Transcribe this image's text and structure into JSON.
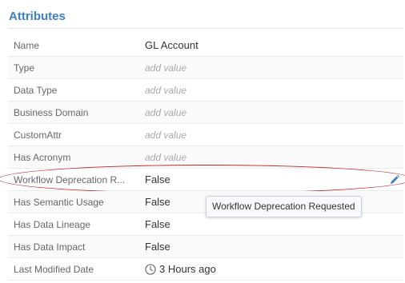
{
  "section": {
    "title": "Attributes"
  },
  "attributes": [
    {
      "label": "Name",
      "value": "GL Account",
      "placeholder": false
    },
    {
      "label": "Type",
      "value": "add value",
      "placeholder": true
    },
    {
      "label": "Data Type",
      "value": "add value",
      "placeholder": true
    },
    {
      "label": "Business Domain",
      "value": "add value",
      "placeholder": true
    },
    {
      "label": "CustomAttr",
      "value": "add value",
      "placeholder": true
    },
    {
      "label": "Has Acronym",
      "value": "add value",
      "placeholder": true
    },
    {
      "label": "Workflow Deprecation R...",
      "value": "False",
      "placeholder": false
    },
    {
      "label": "Has Semantic Usage",
      "value": "False",
      "placeholder": false
    },
    {
      "label": "Has Data Lineage",
      "value": "False",
      "placeholder": false
    },
    {
      "label": "Has Data Impact",
      "value": "False",
      "placeholder": false
    },
    {
      "label": "Last Modified Date",
      "value": "3 Hours ago",
      "placeholder": false
    }
  ],
  "tooltip": {
    "text": "Workflow Deprecation Requested"
  },
  "icons": {
    "edit": "pencil-icon",
    "time": "clock-icon"
  },
  "colors": {
    "accent": "#3a7fc4",
    "highlight": "#c62828"
  }
}
